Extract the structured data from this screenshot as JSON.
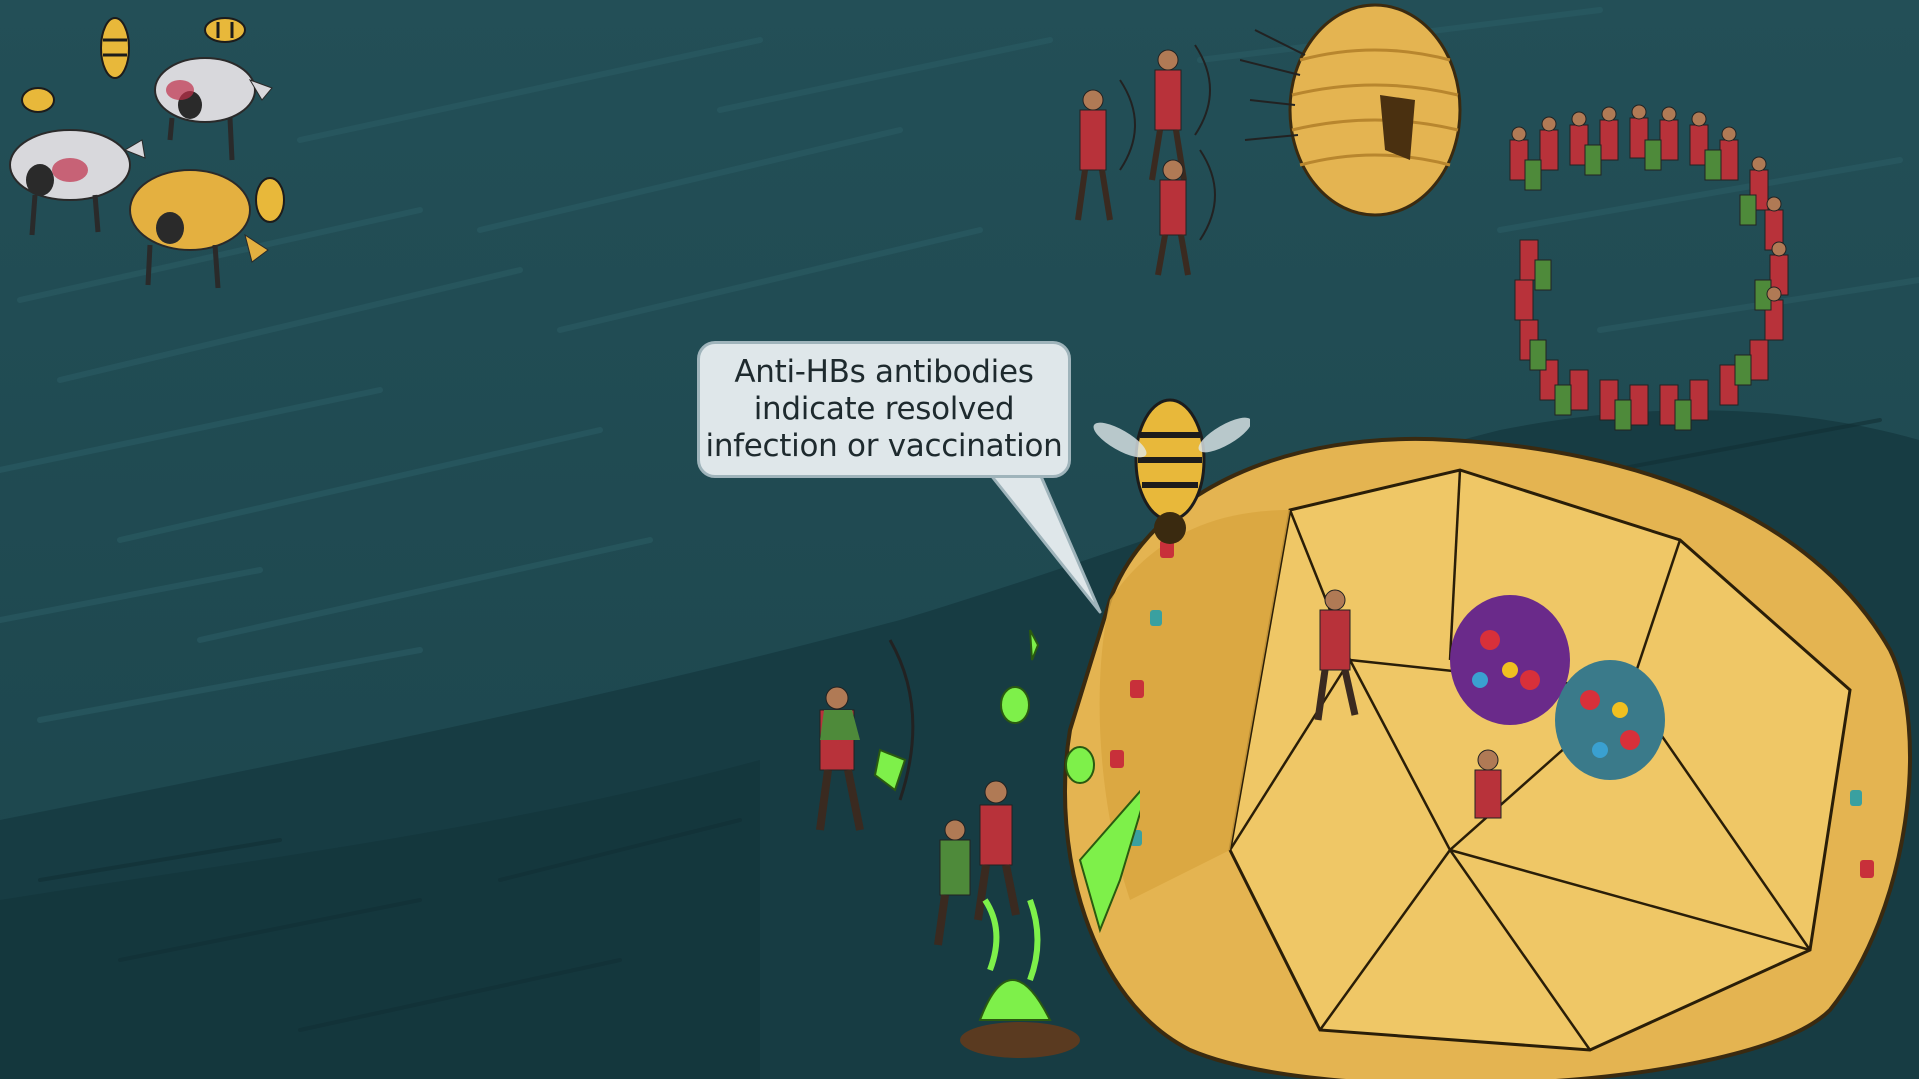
{
  "caption": {
    "text": "Anti-HBs antibodies\nindicate resolved\ninfection or vaccination"
  },
  "palette": {
    "background": "#1f4a52",
    "ground_dark": "#173a41",
    "hive_gold": "#e4b451",
    "hive_shadow": "#b8862e",
    "soldier_red": "#b8323a",
    "soldier_green": "#4e8a3a",
    "virus_green": "#7ef04a",
    "bubble_fill": "#dfe7ea"
  },
  "icons": [
    "bee-icon",
    "cow-icon",
    "archer-icon",
    "hive-icon",
    "gem-icon",
    "cauldron-icon"
  ]
}
